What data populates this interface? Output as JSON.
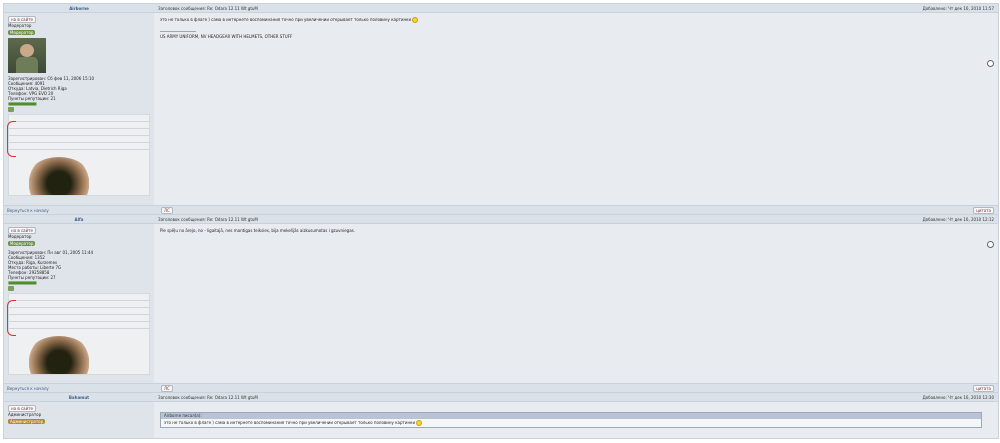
{
  "posts": [
    {
      "author": "Airborne",
      "subject": "Заголовок сообщения: Re: Odara 12.11 Wt gtuM",
      "date": "Добавлено: Чт дек 16, 2010 11:57",
      "button1": "на в сайте",
      "status": "Модератор",
      "rank": "Модератор",
      "info": [
        "Зарегистрирован: Сб фев 11, 2006 15:10",
        "Сообщения: 4091",
        "Откуда: Latvia, Dietrich Riga",
        "Телефон: VPG EVO 20",
        "Пункты репутации: 21"
      ],
      "message": "это не только в флаге ) сама в интернете воспоминания точно при увеличении открывает только половину картинки",
      "signature": "US ARMY UNIFORM, NV HEADGEAR WITH HELMETS, OTHER STUFF",
      "back": "Вернуться к началу",
      "footer_left": "ЛС",
      "footer_right": "цитата"
    },
    {
      "author": "Alfa",
      "subject": "Заголовок сообщения: Re: Odara 12.11 Wt gtuM",
      "date": "Добавлено: Чт дек 16, 2010 12:12",
      "button1": "на в сайте",
      "status": "Модератор",
      "rank": "Модератор",
      "info": [
        "Зарегистрирован: Пн авг 01, 2005 11:44",
        "Сообщения: 1352",
        "Откуда: Riga, Kurzemes",
        "Место работы: Liberte 7G",
        "Телефон: 29258858",
        "Пункты репутации: 27"
      ],
      "message": "Pie spēļu no ārejo, no - ligaitajā, nes mantigas teiksies, bija mekešjās aizkusumotas i gzuvniegas.",
      "back": "Вернуться к началу",
      "footer_left": "ЛС",
      "footer_right": "цитата"
    },
    {
      "author": "Bahamut",
      "subject": "Заголовок сообщения: Re: Odara 12.11 Wt gtuM",
      "date": "Добавлено: Чт дек 16, 2010 12:30",
      "button1": "на в сайте",
      "status": "Администратор",
      "rank": "Администратор",
      "quote_header": "Airborne писал(а):",
      "quote_text": "это не только в флаге ) сама в интернете воспоминания точно при увеличении открывает только половину картинки"
    }
  ]
}
